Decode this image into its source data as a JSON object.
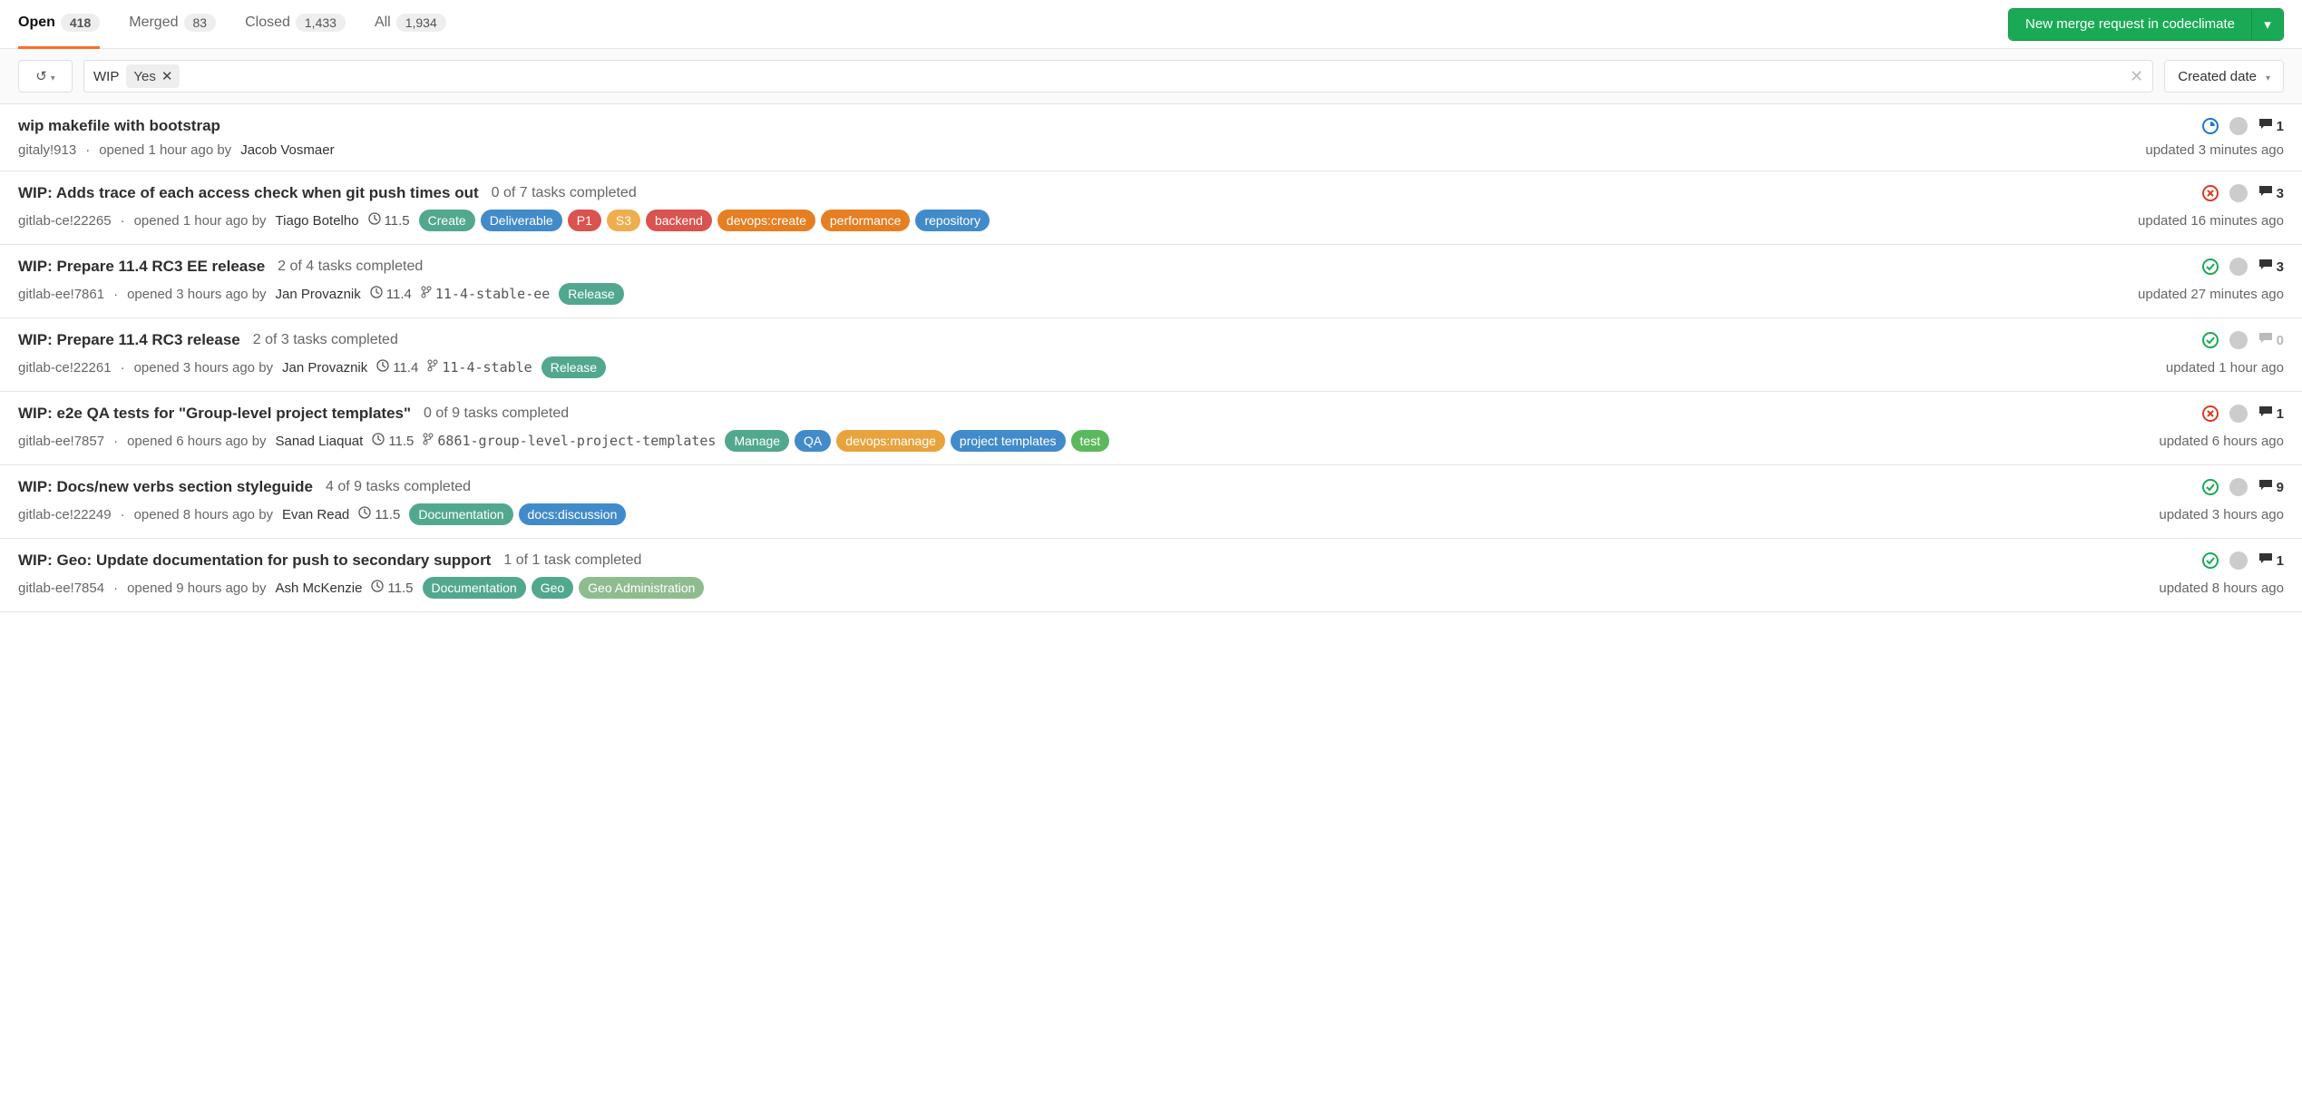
{
  "tabs": [
    {
      "label": "Open",
      "count": "418",
      "active": true
    },
    {
      "label": "Merged",
      "count": "83",
      "active": false
    },
    {
      "label": "Closed",
      "count": "1,433",
      "active": false
    },
    {
      "label": "All",
      "count": "1,934",
      "active": false
    }
  ],
  "new_mr_button": "New merge request in codeclimate",
  "filter": {
    "token_label": "WIP",
    "token_value": "Yes"
  },
  "sort_label": "Created date",
  "merge_requests": [
    {
      "title": "wip makefile with bootstrap",
      "tasks": "",
      "ref": "gitaly!913",
      "opened": "opened 1 hour ago by",
      "author": "Jacob Vosmaer",
      "milestone": "",
      "branch": "",
      "labels": [],
      "status": "running",
      "comments": "1",
      "comments_muted": false,
      "updated": "updated 3 minutes ago"
    },
    {
      "title": "WIP: Adds trace of each access check when git push times out",
      "tasks": "0 of 7 tasks completed",
      "ref": "gitlab-ce!22265",
      "opened": "opened 1 hour ago by",
      "author": "Tiago Botelho",
      "milestone": "11.5",
      "branch": "",
      "labels": [
        {
          "text": "Create",
          "bg": "#52a88f"
        },
        {
          "text": "Deliverable",
          "bg": "#428bca"
        },
        {
          "text": "P1",
          "bg": "#d9534f"
        },
        {
          "text": "S3",
          "bg": "#f0ad4e"
        },
        {
          "text": "backend",
          "bg": "#d9534f"
        },
        {
          "text": "devops:create",
          "bg": "#e67e22"
        },
        {
          "text": "performance",
          "bg": "#e67e22"
        },
        {
          "text": "repository",
          "bg": "#428bca"
        }
      ],
      "status": "failed",
      "comments": "3",
      "comments_muted": false,
      "updated": "updated 16 minutes ago"
    },
    {
      "title": "WIP: Prepare 11.4 RC3 EE release",
      "tasks": "2 of 4 tasks completed",
      "ref": "gitlab-ee!7861",
      "opened": "opened 3 hours ago by",
      "author": "Jan Provaznik",
      "milestone": "11.4",
      "branch": "11-4-stable-ee",
      "labels": [
        {
          "text": "Release",
          "bg": "#52a88f"
        }
      ],
      "status": "success",
      "comments": "3",
      "comments_muted": false,
      "updated": "updated 27 minutes ago"
    },
    {
      "title": "WIP: Prepare 11.4 RC3 release",
      "tasks": "2 of 3 tasks completed",
      "ref": "gitlab-ce!22261",
      "opened": "opened 3 hours ago by",
      "author": "Jan Provaznik",
      "milestone": "11.4",
      "branch": "11-4-stable",
      "labels": [
        {
          "text": "Release",
          "bg": "#52a88f"
        }
      ],
      "status": "success",
      "comments": "0",
      "comments_muted": true,
      "updated": "updated 1 hour ago"
    },
    {
      "title": "WIP: e2e QA tests for \"Group-level project templates\"",
      "tasks": "0 of 9 tasks completed",
      "ref": "gitlab-ee!7857",
      "opened": "opened 6 hours ago by",
      "author": "Sanad Liaquat",
      "milestone": "11.5",
      "branch": "6861-group-level-project-templates",
      "labels": [
        {
          "text": "Manage",
          "bg": "#52a88f"
        },
        {
          "text": "QA",
          "bg": "#428bca"
        },
        {
          "text": "devops:manage",
          "bg": "#e8a33d"
        },
        {
          "text": "project templates",
          "bg": "#428bca"
        },
        {
          "text": "test",
          "bg": "#5cb85c"
        }
      ],
      "status": "failed",
      "comments": "1",
      "comments_muted": false,
      "updated": "updated 6 hours ago"
    },
    {
      "title": "WIP: Docs/new verbs section styleguide",
      "tasks": "4 of 9 tasks completed",
      "ref": "gitlab-ce!22249",
      "opened": "opened 8 hours ago by",
      "author": "Evan Read",
      "milestone": "11.5",
      "branch": "",
      "labels": [
        {
          "text": "Documentation",
          "bg": "#52a88f"
        },
        {
          "text": "docs:discussion",
          "bg": "#428bca"
        }
      ],
      "status": "success",
      "comments": "9",
      "comments_muted": false,
      "updated": "updated 3 hours ago"
    },
    {
      "title": "WIP: Geo: Update documentation for push to secondary support",
      "tasks": "1 of 1 task completed",
      "ref": "gitlab-ee!7854",
      "opened": "opened 9 hours ago by",
      "author": "Ash McKenzie",
      "milestone": "11.5",
      "branch": "",
      "labels": [
        {
          "text": "Documentation",
          "bg": "#52a88f"
        },
        {
          "text": "Geo",
          "bg": "#52a88f"
        },
        {
          "text": "Geo Administration",
          "bg": "#8fbc8f"
        }
      ],
      "status": "success",
      "comments": "1",
      "comments_muted": false,
      "updated": "updated 8 hours ago"
    }
  ]
}
